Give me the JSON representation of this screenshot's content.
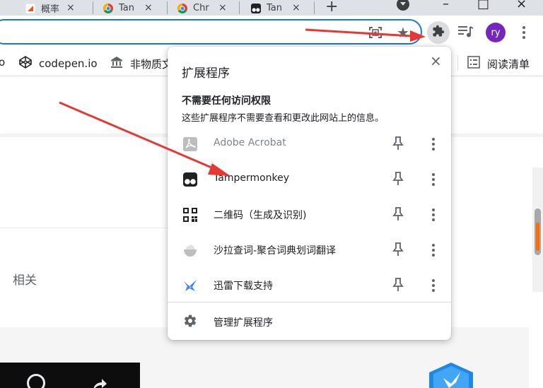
{
  "tabs": [
    {
      "title": "概率",
      "favicon": "orange-page-icon",
      "close": "×"
    },
    {
      "title": "Tan",
      "favicon": "chrome-icon",
      "close": "×"
    },
    {
      "title": "Chr",
      "favicon": "chrome-icon",
      "close": "×"
    },
    {
      "title": "Tan",
      "favicon": "tampermonkey-icon",
      "close": "×"
    }
  ],
  "tabstrip": {
    "new_tab": "+",
    "minimize": "–",
    "maximize": "□",
    "close": "×"
  },
  "toolbar": {
    "avatar_initials": "ry"
  },
  "bookmarks": [
    {
      "label": "o",
      "icon": "none"
    },
    {
      "label": "codepen.io",
      "icon": "codepen-icon"
    },
    {
      "label": "非物质文",
      "icon": "museum-icon"
    },
    {
      "label": "阅读清单",
      "icon": "reading-list-icon"
    }
  ],
  "page": {
    "related_label": "相关"
  },
  "popup": {
    "title": "扩展程序",
    "close": "×",
    "section_title": "不需要任何访问权限",
    "section_desc": "这些扩展程序不需要查看和更改此网站上的信息。",
    "extensions": [
      {
        "name": "Adobe Acrobat",
        "icon": "adobe-acrobat-icon",
        "disabled": true
      },
      {
        "name": "Tampermonkey",
        "icon": "tampermonkey-icon",
        "disabled": false
      },
      {
        "name": "二维码（生成及识别)",
        "icon": "qr-code-icon",
        "disabled": false
      },
      {
        "name": "沙拉查词-聚合词典划词翻译",
        "icon": "salad-dict-icon",
        "disabled": false
      },
      {
        "name": "迅雷下载支持",
        "icon": "thunder-icon",
        "disabled": false
      }
    ],
    "manage_label": "管理扩展程序"
  },
  "colors": {
    "accent": "#1a73e8",
    "avatar": "#7627bb",
    "arrow": "#e53935",
    "scroll_accent": "#ff6d00"
  }
}
